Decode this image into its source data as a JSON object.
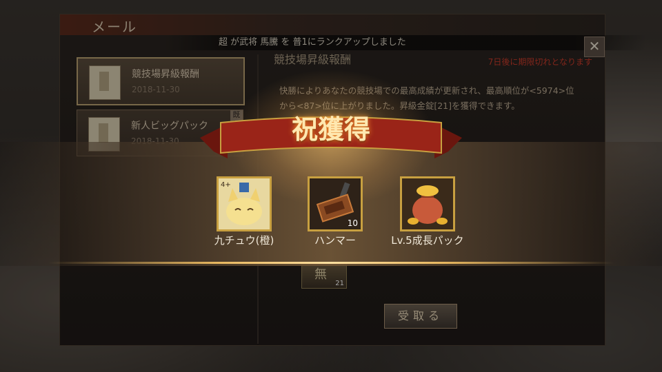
{
  "mail": {
    "title": "メール",
    "marquee": "超 が武将 馬騰 を 普1にランクアップしました",
    "close_symbol": "✕",
    "items": [
      {
        "title": "競技場昇級報酬",
        "date": "2018-11-30"
      },
      {
        "title": "新人ビッグパック",
        "date": "2018-11-30",
        "badge": "既読"
      }
    ]
  },
  "detail": {
    "title": "競技場昇級報酬",
    "expire": "7日後に期限切れとなります",
    "body": "快勝によりあなたの競技場での最高成績が更新され、最高順位が<5974>位から<87>位に上がりました。昇級金錠[21]を獲得できます。",
    "attachment_label": "無",
    "attachment_count": "21",
    "receive_label": "受取る"
  },
  "reward_popup": {
    "title": "祝獲得",
    "items": [
      {
        "name": "九チュウ(橙)",
        "qty": "",
        "badge": "4+"
      },
      {
        "name": "ハンマー",
        "qty": "10",
        "badge": ""
      },
      {
        "name": "Lv.5成長パック",
        "qty": "",
        "badge": ""
      }
    ]
  },
  "colors": {
    "accent_gold": "#e8b860",
    "ribbon_red": "#9a2418",
    "expire_red": "#c83a2a"
  }
}
